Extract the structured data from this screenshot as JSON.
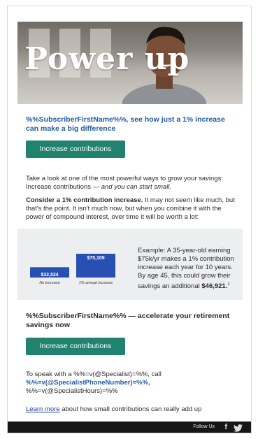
{
  "hero": {
    "title": "Power up"
  },
  "headline": "%%SubscriberFirstName%%, see how just a 1% increase can make a big difference",
  "cta1": {
    "label": "Increase contributions"
  },
  "intro": {
    "text": "Take a look at one of the most powerful ways to grow your savings: Increase contributions —",
    "italic": "and you can start small."
  },
  "consider": {
    "bold": "Consider a 1% contribution increase.",
    "text": " It may not seem like much, but that's the point. It isn't much now, but when you combine it with the power of compound interest, over time it will be worth a lot:"
  },
  "chart_data": {
    "type": "bar",
    "categories": [
      "No increase",
      "1% annual increase"
    ],
    "values": [
      32524,
      75109
    ],
    "value_labels": [
      "$32,524",
      "$75,109"
    ],
    "bar_color": "#2a4fb3"
  },
  "example": {
    "text": "Example: A 35-year-old earning $75k/yr makes a 1% contribution increase each year for 10 years. By age 45, this could grow their savings an additional",
    "amount": "$46,921.",
    "footnote": "1"
  },
  "section2": {
    "headline": "%%SubscriberFirstName%% — accelerate your retirement savings now"
  },
  "cta2": {
    "label": "Increase contributions"
  },
  "contact": {
    "line1": "To speak with a %%=v(@Specialist)=%%, call",
    "phone": "%%=v(@SpecialistPhoneNumber)=%%,",
    "hours": "%%=v(@SpecialistHours)=%%"
  },
  "learn": {
    "link": "Learn more",
    "text": " about how small contributions can really add up"
  },
  "footer": {
    "follow": "Follow Us",
    "facebook_icon": "facebook-icon",
    "twitter_icon": "twitter-icon"
  },
  "colors": {
    "accent_green": "#21826f",
    "link_blue": "#1f5aa6",
    "bar_blue": "#2a4fb3",
    "footer": "#161616"
  }
}
